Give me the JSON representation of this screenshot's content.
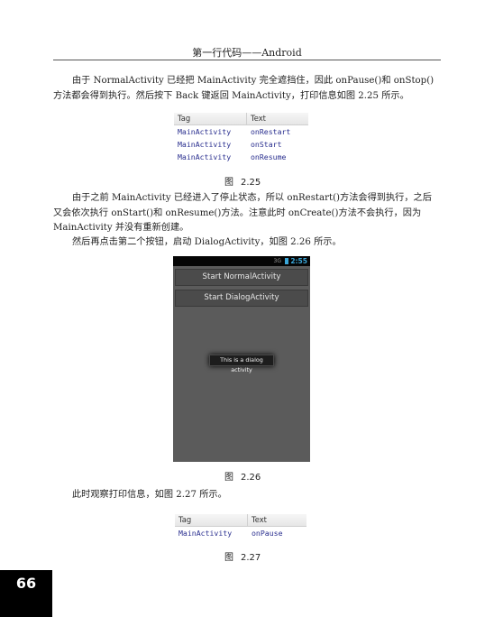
{
  "header": {
    "title": "第一行代码——Android"
  },
  "paragraphs": {
    "p1": "由于 NormalActivity 已经把 MainActivity 完全遮挡住，因此 onPause()和 onStop()方法都会得到执行。然后按下 Back 键返回 MainActivity，打印信息如图 2.25 所示。",
    "p2": "由于之前 MainActivity 已经进入了停止状态，所以 onRestart()方法会得到执行，之后又会依次执行 onStart()和 onResume()方法。注意此时 onCreate()方法不会执行，因为 MainActivity 并没有重新创建。",
    "p3": "然后再点击第二个按钮，启动 DialogActivity，如图 2.26 所示。",
    "p4": "此时观察打印信息，如图 2.27 所示。"
  },
  "log_225": {
    "headers": [
      "Tag",
      "Text"
    ],
    "rows": [
      [
        "MainActivity",
        "onRestart"
      ],
      [
        "MainActivity",
        "onStart"
      ],
      [
        "MainActivity",
        "onResume"
      ]
    ]
  },
  "log_227": {
    "headers": [
      "Tag",
      "Text"
    ],
    "rows": [
      [
        "MainActivity",
        "onPause"
      ]
    ]
  },
  "captions": {
    "fig_word": "图",
    "c225": "2.25",
    "c226": "2.26",
    "c227": "2.27"
  },
  "phone": {
    "status_time": "2:55",
    "status_signal": "3G",
    "button1": "Start NormalActivity",
    "button2": "Start DialogActivity",
    "dialog_text": "This is a dialog activity"
  },
  "page_number": "66",
  "colors": {
    "log_text": "#2a2f8f",
    "status_accent": "#3aa6d8",
    "page_tab": "#000000"
  }
}
